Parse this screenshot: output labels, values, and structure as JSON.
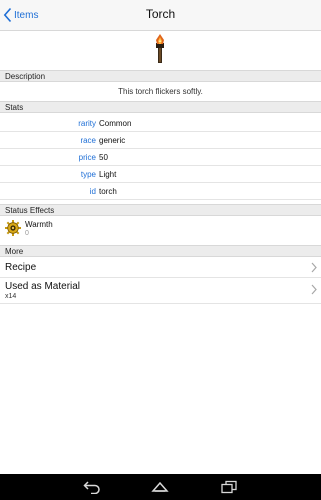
{
  "nav": {
    "back_label": "Items",
    "title": "Torch"
  },
  "sections": {
    "description": "Description",
    "stats": "Stats",
    "status_effects": "Status Effects",
    "more": "More"
  },
  "description_text": "This torch flickers softly.",
  "stats": [
    {
      "key": "rarity",
      "value": "Common"
    },
    {
      "key": "race",
      "value": "generic"
    },
    {
      "key": "price",
      "value": "50"
    },
    {
      "key": "type",
      "value": "Light"
    },
    {
      "key": "id",
      "value": "torch"
    }
  ],
  "effects": [
    {
      "name": "Warmth",
      "sub": "0",
      "icon": "gear-icon"
    }
  ],
  "more": [
    {
      "label": "Recipe"
    },
    {
      "label": "Used as Material",
      "sub": "x14"
    }
  ],
  "colors": {
    "accent": "#1f6fd6",
    "section_bg": "#ececec",
    "nav_bg": "#f7f7f7"
  },
  "icons": {
    "back": "chevron-left-icon",
    "item": "torch-icon",
    "row_chevron": "chevron-right-icon",
    "system": [
      "back-arrow-icon",
      "home-icon",
      "recents-icon"
    ]
  }
}
